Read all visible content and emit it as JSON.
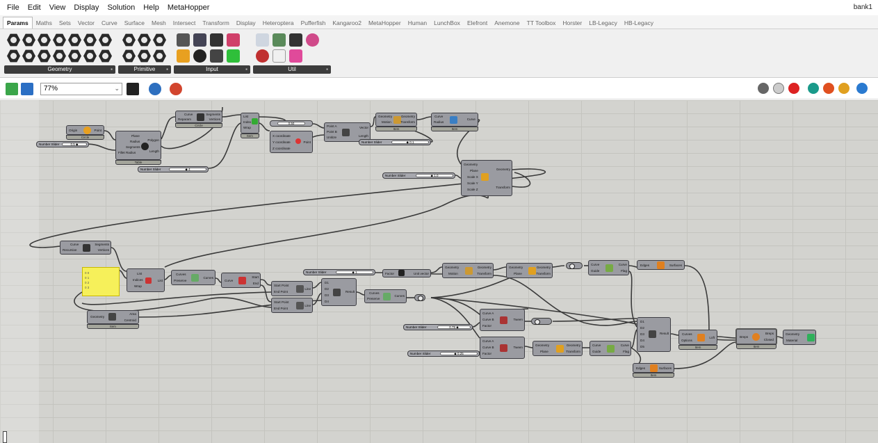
{
  "menu": [
    "File",
    "Edit",
    "View",
    "Display",
    "Solution",
    "Help",
    "MetaHopper"
  ],
  "document_title": "bank1",
  "tabs": [
    "Params",
    "Maths",
    "Sets",
    "Vector",
    "Curve",
    "Surface",
    "Mesh",
    "Intersect",
    "Transform",
    "Display",
    "Heteroptera",
    "Pufferfish",
    "Kangaroo2",
    "MetaHopper",
    "Human",
    "LunchBox",
    "Elefront",
    "Anemone",
    "TT Toolbox",
    "Horster",
    "LB-Legacy",
    "HB-Legacy"
  ],
  "ribbon_panels": [
    "Geometry",
    "Primitive",
    "Input",
    "Util"
  ],
  "toolbar": {
    "zoom": "77%"
  },
  "components": {
    "pt": {
      "in1": "Origin",
      "out1": "Point",
      "foot": "Circle"
    },
    "polygon": {
      "in1": "Plane",
      "in2": "Radius",
      "in3": "Segments",
      "in4": "Fillet Radius",
      "out1": "Polygon",
      "out2": "Length",
      "foot": "Table"
    },
    "divide": {
      "in1": "Curve",
      "in2": "Reparam",
      "out1": "Segments",
      "out2": "Vertices",
      "foot": "Circle"
    },
    "list1": {
      "in1": "List",
      "in2": "Index",
      "in3": "Wrap",
      "foot": "Item"
    },
    "xyz": {
      "in1": "X coordinate",
      "in2": "Y coordinate",
      "in3": "Z coordinate",
      "out1": "Point"
    },
    "vec2pt": {
      "in1": "Point A",
      "in2": "Point B",
      "in3": "Unitize",
      "out1": "Vector",
      "out2": "Length"
    },
    "move1": {
      "in1": "Geometry",
      "in2": "Motion",
      "out1": "Geometry",
      "out2": "Transform",
      "foot": "Item"
    },
    "offset1": {
      "in1": "Curve",
      "in2": "Radius",
      "out1": "Curve",
      "foot": "Item"
    },
    "scale": {
      "in1": "Geometry",
      "in2": "Plane",
      "in3": "Scale X",
      "in4": "Scale Y",
      "in5": "Scale Z",
      "out1": "Geometry",
      "out2": "Transform"
    },
    "explode": {
      "in1": "Curve",
      "in2": "Recursive",
      "out1": "Segments",
      "out2": "Vertices"
    },
    "list2": {
      "in1": "List",
      "in2": "Indices",
      "in3": "Wrap",
      "out1": "List"
    },
    "join": {
      "in1": "Curves",
      "in2": "Preserve",
      "out1": "Curves"
    },
    "endpts": {
      "in1": "Curve",
      "out1": "Start",
      "out2": "End"
    },
    "line1": {
      "in1": "Start Point",
      "in2": "End Point",
      "out1": "Line"
    },
    "line2": {
      "in1": "Start Point",
      "in2": "End Point",
      "out1": "Line"
    },
    "merge1": {
      "in1": "D1",
      "in2": "D2",
      "in3": "D3",
      "in4": "D4",
      "out1": "Result"
    },
    "join2": {
      "in1": "Curves",
      "in2": "Preserve",
      "out1": "Curves"
    },
    "area": {
      "in1": "Geometry",
      "out1": "Area",
      "out2": "Centroid",
      "foot": "Item"
    },
    "amp": {
      "in1": "Vector",
      "in2": "Factor",
      "out1": "Unit vector"
    },
    "move2": {
      "in1": "Geometry",
      "in2": "Motion",
      "out1": "Geometry",
      "out2": "Transform"
    },
    "mirror": {
      "in1": "Geometry",
      "in2": "Plane",
      "out1": "Geometry",
      "out2": "Transform"
    },
    "flip1": {
      "in1": "Curve",
      "in2": "Guide",
      "out1": "Curve",
      "out2": "Flag"
    },
    "edges1": {
      "in1": "Edges",
      "out1": "Surfaces"
    },
    "tween1": {
      "in1": "Curve A",
      "in2": "Curve B",
      "in3": "Factor",
      "out1": "Tween"
    },
    "tween2": {
      "in1": "Curve A",
      "in2": "Curve B",
      "in3": "Factor",
      "out1": "Tween"
    },
    "mirror2": {
      "in1": "Geometry",
      "in2": "Plane",
      "out1": "Geometry",
      "out2": "Transform"
    },
    "flip2": {
      "in1": "Curve",
      "in2": "Guide",
      "out1": "Curve",
      "out2": "Flag"
    },
    "edges2": {
      "in1": "Edges",
      "out1": "Surfaces",
      "foot": "Item"
    },
    "merge2": {
      "in1": "D1",
      "in2": "D2",
      "in3": "D3",
      "in4": "D4",
      "in5": "D5",
      "out1": "Result"
    },
    "loft": {
      "in1": "Curves",
      "in2": "Options",
      "out1": "Loft",
      "foot": "Item"
    },
    "brep": {
      "in1": "Breps",
      "out1": "Breps",
      "out2": "Closed",
      "foot": "Item"
    },
    "preview": {
      "in1": "Geometry",
      "in2": "Material"
    }
  },
  "sliders": {
    "s1": {
      "label": "Number Slider",
      "value": "0.5 ◆"
    },
    "s2": {
      "label": "Number Slider",
      "value": "◆ 4"
    },
    "s3": {
      "label": "Number Slider",
      "value": "◆ 0.1"
    },
    "s4": {
      "label": "Number Slider",
      "value": "◆ 1.0"
    },
    "s5": {
      "label": "Number Slider",
      "value": "◆ 1"
    },
    "s6": {
      "label": "Number Slider",
      "value": "0.75 ◆"
    },
    "s7": {
      "label": "Number Slider",
      "value": "◆ 0.25"
    },
    "s8": {
      "label": "",
      "value": "0.50"
    }
  },
  "panel_yellow": {
    "lines": [
      "0 0",
      "0 1",
      "0 2",
      "0 3"
    ]
  },
  "colors": {
    "canvas": "#d3d3cf",
    "component": "#9a9ba1",
    "panel": "#f6f05a",
    "ribbon_label": "#3c3c3c"
  }
}
